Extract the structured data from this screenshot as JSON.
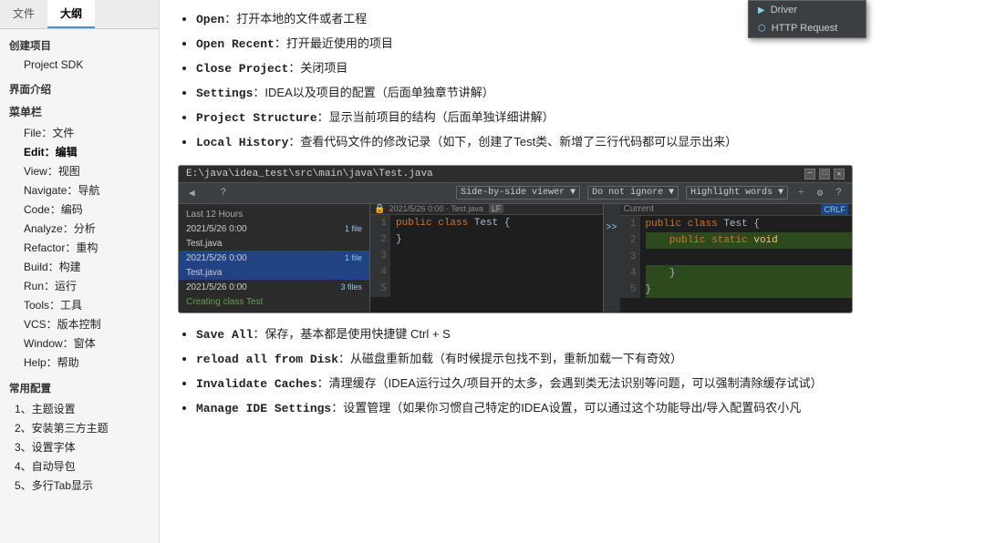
{
  "sidebar": {
    "tab_file": "文件",
    "tab_outline": "大纲",
    "sections": [
      {
        "type": "section",
        "label": "创建项目"
      },
      {
        "type": "item",
        "label": "Project SDK",
        "indent": true
      },
      {
        "type": "section",
        "label": "界面介绍"
      },
      {
        "type": "subsection",
        "label": "菜单栏"
      },
      {
        "type": "item",
        "label": "File：文件",
        "indent": true
      },
      {
        "type": "item",
        "label": "Edit：编辑",
        "indent": true,
        "bold": true
      },
      {
        "type": "item",
        "label": "View：视图",
        "indent": true
      },
      {
        "type": "item",
        "label": "Navigate：导航",
        "indent": true
      },
      {
        "type": "item",
        "label": "Code：编码",
        "indent": true
      },
      {
        "type": "item",
        "label": "Analyze：分析",
        "indent": true
      },
      {
        "type": "item",
        "label": "Refactor：重构",
        "indent": true
      },
      {
        "type": "item",
        "label": "Build：构建",
        "indent": true
      },
      {
        "type": "item",
        "label": "Run：运行",
        "indent": true
      },
      {
        "type": "item",
        "label": "Tools：工具",
        "indent": true
      },
      {
        "type": "item",
        "label": "VCS：版本控制",
        "indent": true
      },
      {
        "type": "item",
        "label": "Window：窗体",
        "indent": true
      },
      {
        "type": "item",
        "label": "Help：帮助",
        "indent": true
      },
      {
        "type": "section",
        "label": "常用配置"
      },
      {
        "type": "item",
        "label": "1、主题设置",
        "indent": false
      },
      {
        "type": "item",
        "label": "2、安装第三方主题",
        "indent": false
      },
      {
        "type": "item",
        "label": "3、设置字体",
        "indent": false
      },
      {
        "type": "item",
        "label": "4、自动导包",
        "indent": false
      },
      {
        "type": "item",
        "label": "5、多行Tab显示",
        "indent": false
      }
    ]
  },
  "main": {
    "title_bar_path": "E:\\java\\idea_test\\src\\main\\java\\Test.java",
    "popup_items": [
      {
        "icon": "▶",
        "label": "Driver"
      },
      {
        "icon": "⬡",
        "label": "HTTP Request"
      }
    ],
    "toolbar": {
      "back": "◀",
      "forward": "▶",
      "help": "?",
      "viewer_dropdown": "Side-by-side viewer ▼",
      "ignore_dropdown": "Do not ignore ▼",
      "highlight_dropdown": "Highlight words ▼",
      "divider": "÷",
      "settings": "⚙",
      "question": "?"
    },
    "history_header": "Last 12 Hours",
    "history_items": [
      {
        "date": "2021/5/26 0:00",
        "label": "Test.java",
        "count": "1 file",
        "selected": false
      },
      {
        "date": "2021/5/26 0:00",
        "label": "Test.java",
        "count": "1 file",
        "selected": true
      },
      {
        "date": "2021/5/26 0:00",
        "label": "3 files",
        "count": "",
        "selected": false
      }
    ],
    "creating_label": "Creating class Test",
    "lf_label": "LF",
    "current_label": "Current",
    "crlf_label": "CRLF",
    "file_date": "2021/5/26 0:00 · Test.java",
    "old_code_lines": [
      "1",
      "2",
      "3",
      "4",
      "5"
    ],
    "old_code": [
      "public class Test {",
      "}",
      "",
      "",
      ""
    ],
    "new_code_lines": [
      "1",
      "2",
      "3",
      "4",
      "5"
    ],
    "new_code": [
      "public class Test {",
      "    public static void",
      "",
      "    }",
      "}"
    ],
    "arrow_line": 2,
    "bullets": [
      {
        "key": "Open",
        "colon": "：",
        "text": "打开本地的文件或者工程"
      },
      {
        "key": "Open Recent",
        "colon": "：",
        "text": "打开最近使用的项目"
      },
      {
        "key": "Close Project",
        "colon": "：",
        "text": "关闭项目"
      },
      {
        "key": "Settings",
        "colon": "：",
        "text": "IDEA以及项目的配置（后面单独章节讲解）"
      },
      {
        "key": "Project Structure",
        "colon": "：",
        "text": "显示当前项目的结构（后面单独详细讲解）"
      },
      {
        "key": "Local History",
        "colon": "：",
        "text": "查看代码文件的修改记录（如下，创建了Test类、新增了三行代码都可以显示出来）"
      }
    ],
    "bullets_bottom": [
      {
        "key": "Save All",
        "colon": "：",
        "text": "保存，基本都是使用快捷键 Ctrl + S"
      },
      {
        "key": "reload all from Disk",
        "colon": "：",
        "text": "从磁盘重新加载（有时候提示包找不到，重新加载一下有奇效）"
      },
      {
        "key": "Invalidate Caches",
        "colon": "：",
        "text": "清理缓存（IDEA运行过久/项目开的太多，会遇到类无法识别等问题，可以强制清除缓存试试）"
      },
      {
        "key": "Manage IDE Settings",
        "colon": "：",
        "text": "设置管理（如果你习惯自己特定的IDEA设置，可以通过这个功能导出/导入配置码农小凡"
      }
    ]
  }
}
